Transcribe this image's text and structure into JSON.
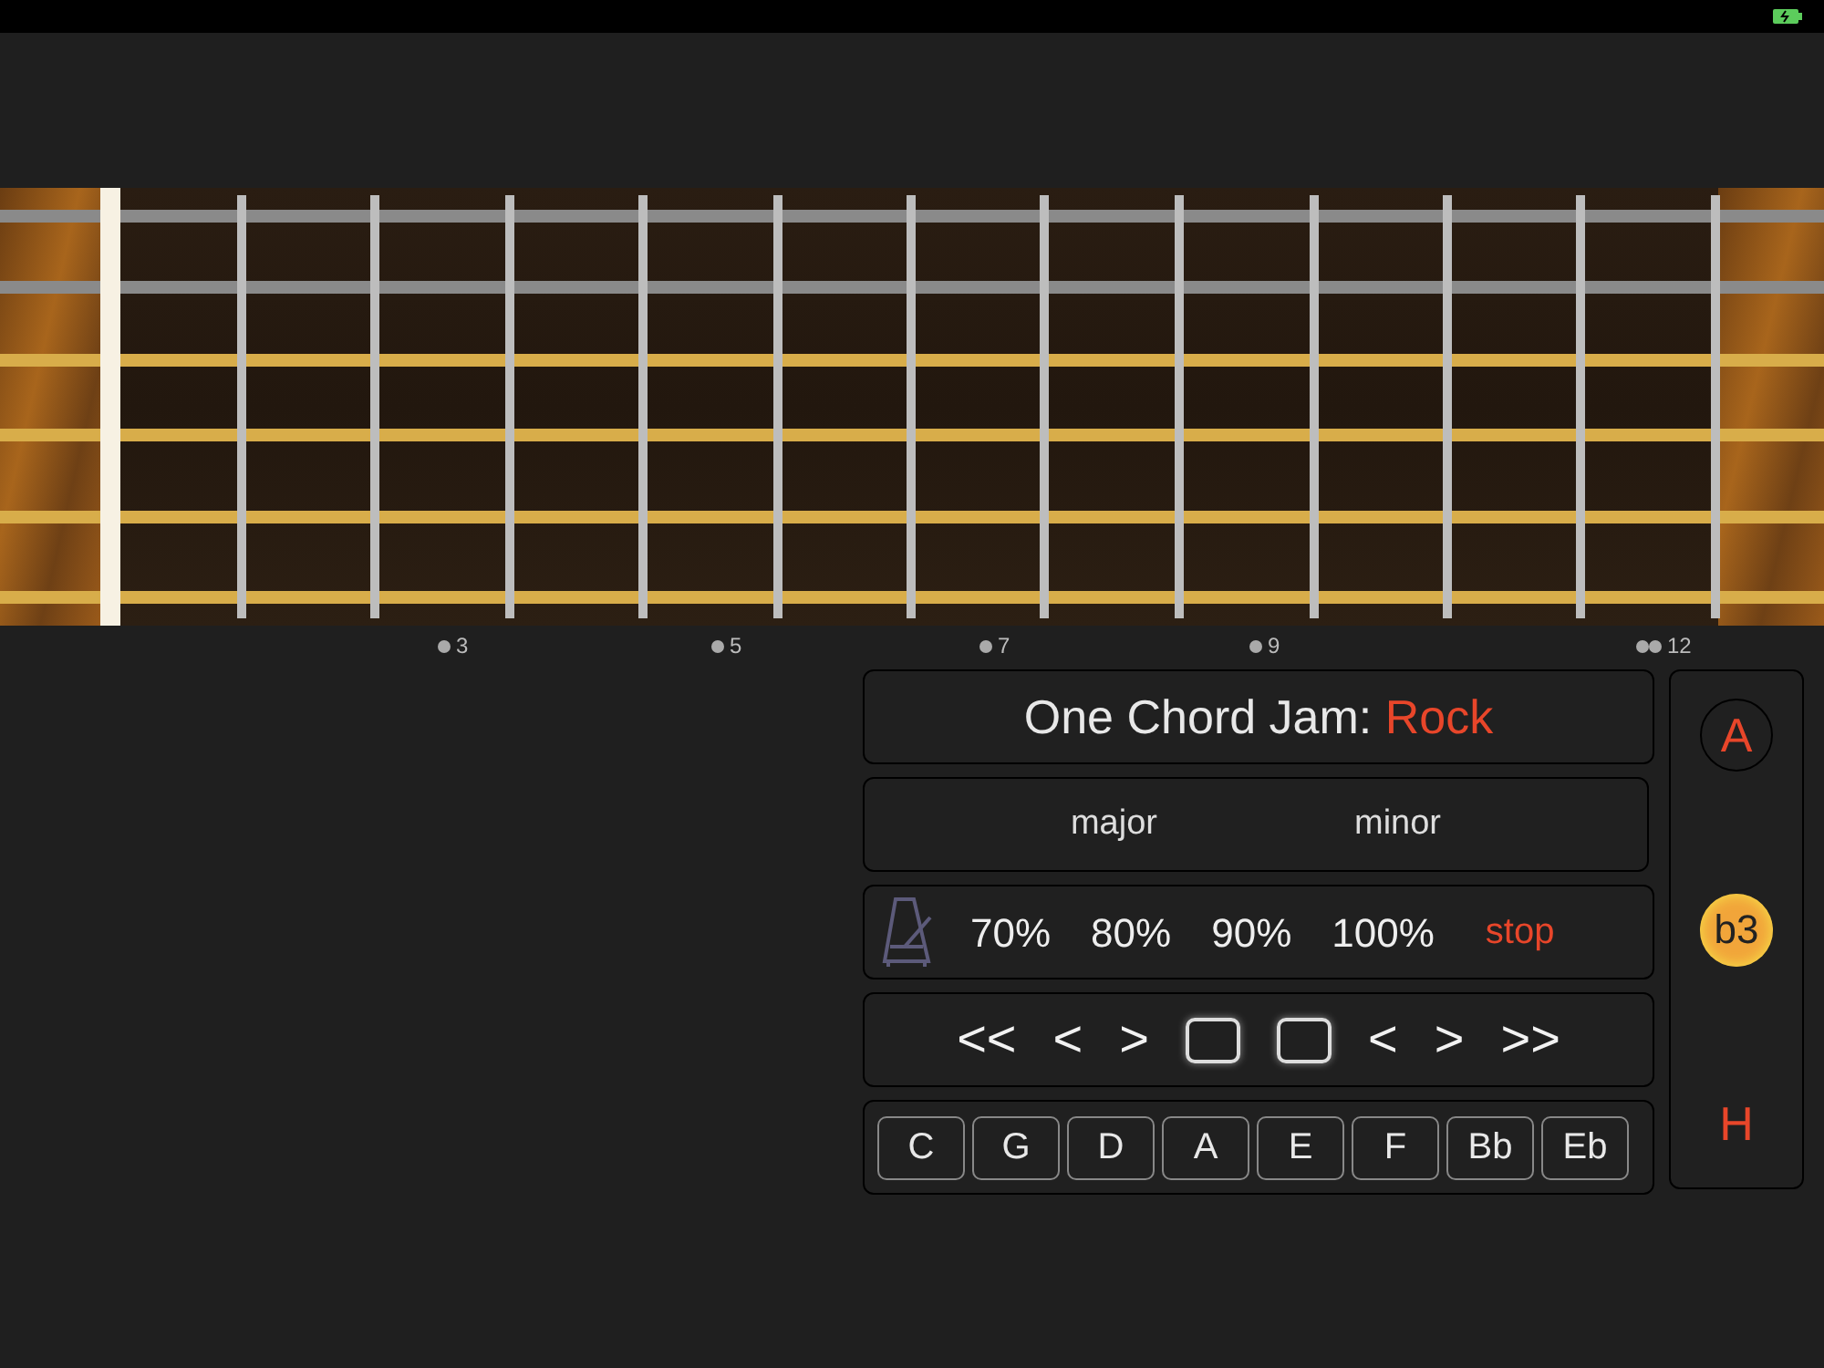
{
  "status_bar": {
    "charging": true
  },
  "fret_markers": [
    {
      "label": "3",
      "kind": "single"
    },
    {
      "label": "5",
      "kind": "single"
    },
    {
      "label": "7",
      "kind": "single"
    },
    {
      "label": "9",
      "kind": "single"
    },
    {
      "label": "12",
      "kind": "double"
    }
  ],
  "title": {
    "text": "One Chord Jam:",
    "style": "Rock"
  },
  "modes": [
    {
      "label": "major"
    },
    {
      "label": "minor"
    }
  ],
  "tempo": [
    {
      "label": "70%",
      "kind": "speed"
    },
    {
      "label": "80%",
      "kind": "speed"
    },
    {
      "label": "90%",
      "kind": "speed"
    },
    {
      "label": "100%",
      "kind": "speed"
    },
    {
      "label": "stop",
      "kind": "stop"
    }
  ],
  "transport": [
    {
      "label": "<<",
      "kind": "text"
    },
    {
      "label": "<",
      "kind": "text"
    },
    {
      "label": ">",
      "kind": "text"
    },
    {
      "kind": "square"
    },
    {
      "kind": "square"
    },
    {
      "label": "<",
      "kind": "text"
    },
    {
      "label": ">",
      "kind": "text"
    },
    {
      "label": ">>",
      "kind": "text"
    }
  ],
  "keys": [
    "C",
    "G",
    "D",
    "A",
    "E",
    "F",
    "Bb",
    "Eb"
  ],
  "side": [
    {
      "label": "A",
      "kind": "ring"
    },
    {
      "label": "b3",
      "kind": "dot"
    },
    {
      "label": "H",
      "kind": "plain"
    }
  ]
}
